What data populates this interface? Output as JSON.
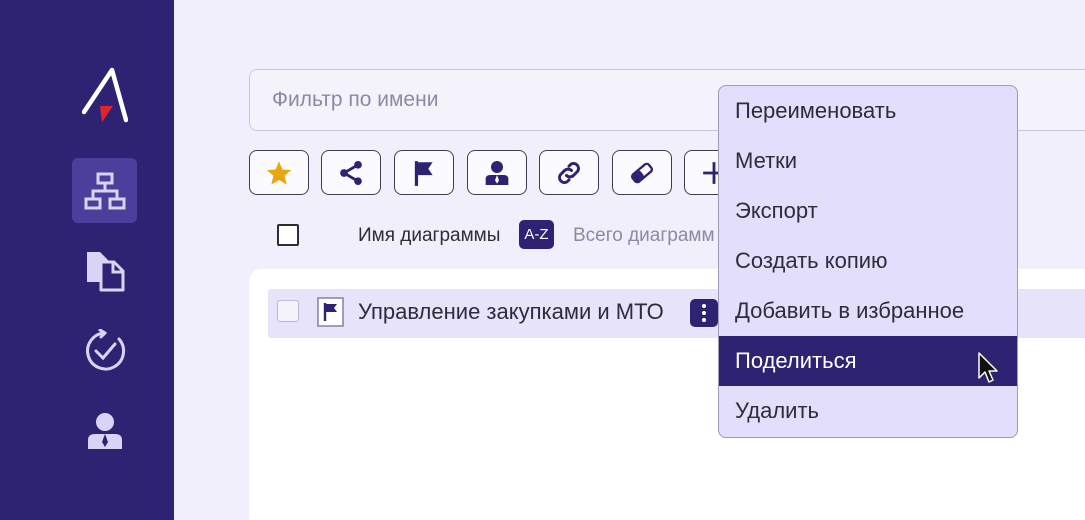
{
  "sidebar": {
    "items": [
      {
        "icon": "org-chart-icon",
        "active": true
      },
      {
        "icon": "documents-icon",
        "active": false
      },
      {
        "icon": "check-circle-icon",
        "active": false
      },
      {
        "icon": "user-icon",
        "active": false
      }
    ]
  },
  "filter": {
    "placeholder": "Фильтр по имени",
    "value": ""
  },
  "toolbar": {
    "buttons": [
      "star-icon",
      "share-icon",
      "flag-icon",
      "user-icon",
      "link-icon",
      "eraser-icon",
      "plus-icon"
    ]
  },
  "list_header": {
    "name_label": "Имя диаграммы",
    "sort_badge": "A-Z",
    "total_label": "Всего диаграмм"
  },
  "rows": [
    {
      "name": "Управление закупками и МТО",
      "icon": "diagram-flag-icon"
    }
  ],
  "context_menu": {
    "items": [
      {
        "label": "Переименовать"
      },
      {
        "label": "Метки"
      },
      {
        "label": "Экспорт"
      },
      {
        "label": "Создать копию"
      },
      {
        "label": "Добавить в избранное"
      },
      {
        "label": "Поделиться",
        "selected": true
      },
      {
        "label": "Удалить"
      }
    ]
  },
  "colors": {
    "sidebar": "#2e2373",
    "accent": "#2e2373",
    "star": "#e8a712",
    "menu_bg": "#e3defc",
    "row_bg": "#e7e3fb"
  }
}
